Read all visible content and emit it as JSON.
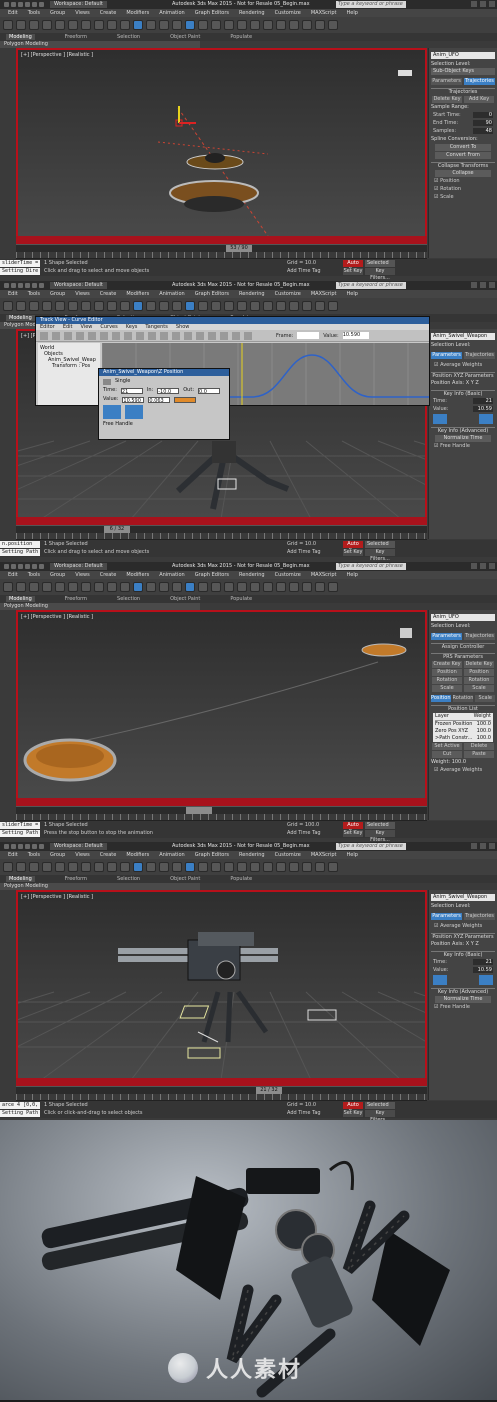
{
  "app": {
    "workspace": "Workspace: Default",
    "search_placeholder": "Type a keyword or phrase"
  },
  "menu": [
    "Edit",
    "Tools",
    "Group",
    "Views",
    "Create",
    "Modifiers",
    "Animation",
    "Graph Editors",
    "Rendering",
    "Customize",
    "MAXScript",
    "Help"
  ],
  "ribbon_tabs": [
    "Modeling",
    "Freeform",
    "Selection",
    "Object Paint",
    "Populate"
  ],
  "sub_ribbon": "Polygon Modeling",
  "panels": [
    {
      "title": "Autodesk 3ds Max 2015 - Not for Resale  05_Begin.max",
      "viewport_label": "[+] [Perspective ] [Realistic ]",
      "frame": "53 / 90",
      "status_selected": "1 Shape Selected",
      "status_prompt": "Click and drag to select and move objects",
      "maxscript_top": "sliderTime =",
      "maxscript_bottom": "Setting Dire",
      "grid": "Grid = 10.0",
      "auto_key": "Auto Key",
      "selected": "Selected",
      "set_key": "Set Key",
      "key_filters": "Key Filters...",
      "add_time_tag": "Add Time Tag",
      "cmd": {
        "object_name": "Anim_UFO",
        "selection_level": "Selection Level:",
        "dropdown": "Sub-Object  Keys",
        "tabs": [
          "Parameters",
          "Trajectories"
        ],
        "rollout": "Trajectories",
        "buttons": [
          "Delete Key",
          "Add Key"
        ],
        "sample_range": "Sample Range:",
        "rows": [
          {
            "label": "Start Time:",
            "value": "0"
          },
          {
            "label": "End Time:",
            "value": "90"
          },
          {
            "label": "Samples:",
            "value": "48"
          }
        ],
        "spline_conv": "Spline Conversion:",
        "convert_to": "Convert To",
        "convert_from": "Convert From",
        "collapse_title": "Collapse Transforms",
        "collapse": "Collapse",
        "checks": [
          "Position",
          "Rotation",
          "Scale"
        ]
      }
    },
    {
      "title": "Autodesk 3ds Max 2015 - Not for Resale  05_Begin.max",
      "viewport_label": "[+] [Perspective ] [Realistic ]",
      "frame": "6 / 32",
      "status_selected": "1 Shape Selected",
      "status_prompt": "Click and drag to select and move objects",
      "maxscript_top": "n.position",
      "maxscript_bottom": "Setting Path",
      "grid": "Grid = 10.0",
      "auto_key": "Auto Key",
      "selected": "Selected",
      "set_key": "Set Key",
      "key_filters": "Key Filters...",
      "add_time_tag": "Add Time Tag",
      "curve_editor": {
        "title": "Track View - Curve Editor",
        "menu": [
          "Editor",
          "Edit",
          "View",
          "Curves",
          "Keys",
          "Tangents",
          "Show"
        ],
        "frame_label": "Frame:",
        "value_label": "Value:",
        "value": "10.590",
        "tree": [
          "World",
          "Objects",
          "Anim_Swivel_Weap",
          "Transform : Pos"
        ]
      },
      "pos_dialog": {
        "title": "Anim_Swivel_Weapon\\Z Position",
        "single": "Single",
        "time_label": "Time:",
        "time": "21",
        "value_label": "Value:",
        "value": "10.590",
        "in_label": "In:",
        "out_label": "Out:",
        "in_val": "-10.0",
        "out_val": "0.0",
        "in_val2": "0.063",
        "free_handle": "Free Handle"
      },
      "cmd": {
        "object_name": "Anim_Swivel_Weapon",
        "selection_level": "Selection Level:",
        "dropdown": "Sub-Object  Keys",
        "tabs": [
          "Parameters",
          "Trajectories"
        ],
        "rollout": "Position XYZ Parameters",
        "average_weights": "Average Weights",
        "axis": "Position Axis:  X  Y  Z",
        "key_info_basic": "Key Info (Basic)",
        "rows": [
          {
            "label": "Time:",
            "value": "21"
          },
          {
            "label": "Value:",
            "value": "10.59"
          }
        ],
        "key_info_adv": "Key Info (Advanced)",
        "normalize": "Normalize Time",
        "free_handle": "Free Handle"
      }
    },
    {
      "title": "Autodesk 3ds Max 2015 - Not for Resale  05_Begin.max",
      "viewport_label": "[+] [Perspective ] [Realistic ]",
      "status_selected": "1 Shape Selected",
      "status_prompt": "Press the stop button to stop the animation",
      "maxscript_top": "sliderTime =",
      "maxscript_bottom": "Setting Path",
      "grid": "Grid = 100.0",
      "auto_key": "Auto Key",
      "selected": "Selected",
      "set_key": "Set Key",
      "key_filters": "Key Filters...",
      "add_time_tag": "Add Time Tag",
      "cmd": {
        "object_name": "Anim_UFO",
        "selection_level": "Selection Level:",
        "tabs": [
          "Parameters",
          "Trajectories"
        ],
        "rollout": "Assign Controller",
        "prs": "PRS Parameters",
        "prs_btns": [
          [
            "Create Key",
            "Delete Key"
          ],
          [
            "Position",
            "Position"
          ],
          [
            "Rotation",
            "Rotation"
          ],
          [
            "Scale",
            "Scale"
          ]
        ],
        "prs_tabs": [
          "Position",
          "Rotation",
          "Scale"
        ],
        "pos_list": "Position List",
        "list_header": [
          "Layer",
          "Weight"
        ],
        "list_rows": [
          {
            "layer": "Frozen Position",
            "weight": "100.0"
          },
          {
            "layer": "Zero Pos XYZ",
            "weight": "100.0"
          },
          {
            "layer": ">Path Constr...",
            "weight": "100.0"
          }
        ],
        "list_btns": [
          [
            "Set Active",
            "Delete"
          ],
          [
            "Cut",
            "Paste"
          ]
        ],
        "weight_row": "Weight: 100.0",
        "average": "Average Weights"
      }
    },
    {
      "title": "Autodesk 3ds Max 2015 - Not for Resale  05_Begin.max",
      "viewport_label": "[+] [Perspective ] [Realistic ]",
      "frame": "21 / 32",
      "status_selected": "1 Shape Selected",
      "status_prompt": "Click or click-and-drag to select objects",
      "maxscript_top": "arce 4 [0,0,",
      "maxscript_bottom": "Setting Path",
      "grid": "Grid = 10.0",
      "auto_key": "Auto Key",
      "selected": "Selected",
      "set_key": "Set Key",
      "key_filters": "Key Filters...",
      "add_time_tag": "Add Time Tag",
      "cmd": {
        "object_name": "Anim_Swivel_Weapon",
        "selection_level": "Selection Level:",
        "tabs": [
          "Parameters",
          "Trajectories"
        ],
        "average_weights": "Average Weights",
        "rollout": "Position XYZ Parameters",
        "axis": "Position Axis:  X  Y  Z",
        "key_info_basic": "Key Info (Basic)",
        "rows": [
          {
            "label": "Time:",
            "value": "21"
          },
          {
            "label": "Value:",
            "value": "10.59"
          }
        ],
        "key_info_adv": "Key Info (Advanced)",
        "normalize": "Normalize Time",
        "free_handle": "Free Handle"
      }
    }
  ],
  "watermark": "人人素材",
  "colors": {
    "accent": "#3b7fc4",
    "autokey": "#b31c1c",
    "frame": "#a8121c",
    "orange": "#c27a2a"
  }
}
